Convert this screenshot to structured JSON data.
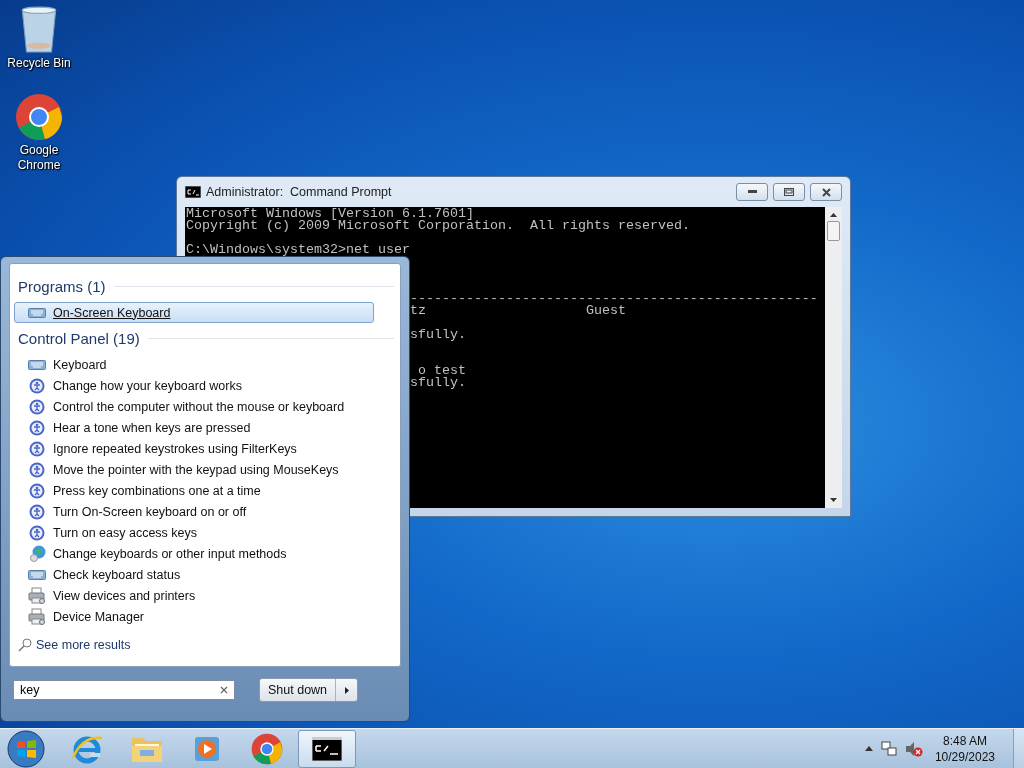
{
  "desktop_icons": [
    {
      "kind": "bin",
      "label": "Recycle Bin"
    },
    {
      "kind": "chrome",
      "label": "Google Chrome"
    }
  ],
  "console_window": {
    "title": "Administrator:  Command Prompt",
    "output": "Microsoft Windows [Version 6.1.7601]\nCopyright (c) 2009 Microsoft Corporation.  All rights reserved.\n\nC:\\Windows\\system32>net user",
    "output_right_of_menu": "---------------------------------------------------\ntz                    Guest\n\nsfully.\n\n\n o test\nsfully."
  },
  "start_menu": {
    "groups": [
      {
        "heading": "Programs (1)",
        "items": [
          {
            "kind": "keyboard",
            "label": "On-Screen Keyboard",
            "selected": true
          }
        ]
      },
      {
        "heading": "Control Panel (19)",
        "items": [
          {
            "kind": "keyboard",
            "label": "Keyboard",
            "selected": false
          },
          {
            "kind": "access",
            "label": "Change how your keyboard works",
            "selected": false
          },
          {
            "kind": "access",
            "label": "Control the computer without the mouse or keyboard",
            "selected": false
          },
          {
            "kind": "access",
            "label": "Hear a tone when keys are pressed",
            "selected": false
          },
          {
            "kind": "access",
            "label": "Ignore repeated keystrokes using FilterKeys",
            "selected": false
          },
          {
            "kind": "access",
            "label": "Move the pointer with the keypad using MouseKeys",
            "selected": false
          },
          {
            "kind": "access",
            "label": "Press key combinations one at a time",
            "selected": false
          },
          {
            "kind": "access",
            "label": "Turn On-Screen keyboard on or off",
            "selected": false
          },
          {
            "kind": "access",
            "label": "Turn on easy access keys",
            "selected": false
          },
          {
            "kind": "globe",
            "label": "Change keyboards or other input methods",
            "selected": false
          },
          {
            "kind": "keyboard",
            "label": "Check keyboard status",
            "selected": false
          },
          {
            "kind": "printer",
            "label": "View devices and printers",
            "selected": false
          },
          {
            "kind": "printer",
            "label": "Device Manager",
            "selected": false
          }
        ]
      }
    ],
    "see_more": "See more results",
    "search": {
      "value": "key"
    },
    "shutdown": "Shut down"
  },
  "taskbar": {
    "apps": [
      {
        "kind": "ie",
        "selected": false
      },
      {
        "kind": "folder",
        "selected": false
      },
      {
        "kind": "media",
        "selected": false
      },
      {
        "kind": "chrome",
        "selected": false
      },
      {
        "kind": "console",
        "selected": true
      }
    ],
    "clock": {
      "time": "8:48 AM",
      "date": "10/29/2023"
    }
  }
}
